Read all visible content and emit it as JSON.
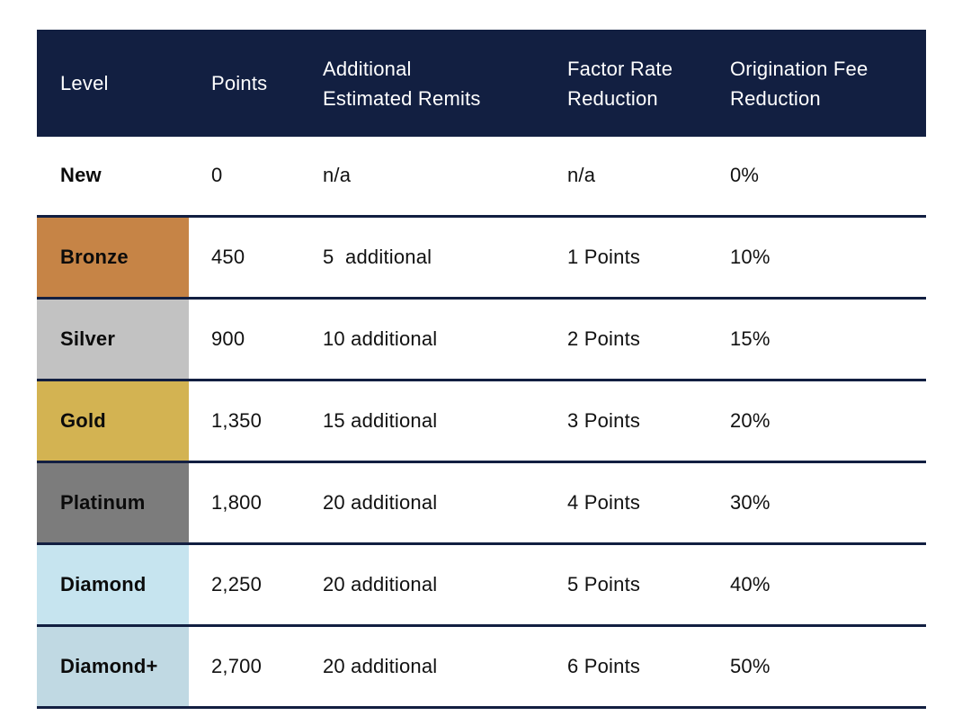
{
  "table": {
    "headers": {
      "level": [
        "Level"
      ],
      "points": [
        "Points"
      ],
      "remits": [
        "Additional",
        "Estimated Remits"
      ],
      "factor": [
        "Factor Rate",
        "Reduction"
      ],
      "fee": [
        "Origination Fee",
        "Reduction"
      ]
    },
    "header_color": "#121f41",
    "rows": [
      {
        "level": "New",
        "points": "0",
        "remits": "n/a",
        "factor": "n/a",
        "fee": "0%",
        "color": "#ffffff"
      },
      {
        "level": "Bronze",
        "points": "450",
        "remits": "5  additional",
        "factor": "1 Points",
        "fee": "10%",
        "color": "#c68446"
      },
      {
        "level": "Silver",
        "points": "900",
        "remits": "10 additional",
        "factor": "2 Points",
        "fee": "15%",
        "color": "#c2c2c2"
      },
      {
        "level": "Gold",
        "points": "1,350",
        "remits": "15 additional",
        "factor": "3 Points",
        "fee": "20%",
        "color": "#d3b352"
      },
      {
        "level": "Platinum",
        "points": "1,800",
        "remits": "20 additional",
        "factor": "4 Points",
        "fee": "30%",
        "color": "#7c7c7c"
      },
      {
        "level": "Diamond",
        "points": "2,250",
        "remits": "20 additional",
        "factor": "5 Points",
        "fee": "40%",
        "color": "#c6e4ef"
      },
      {
        "level": "Diamond+",
        "points": "2,700",
        "remits": "20 additional",
        "factor": "6 Points",
        "fee": "50%",
        "color": "#c0d9e3"
      }
    ]
  }
}
